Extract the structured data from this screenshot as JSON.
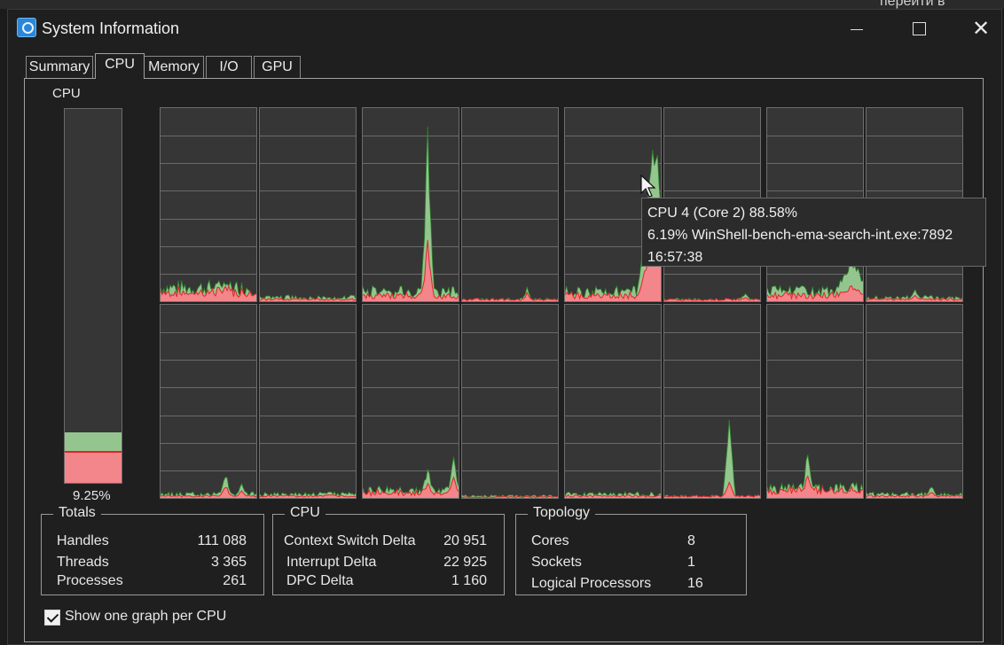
{
  "background": {
    "right_text": "перейти в"
  },
  "window": {
    "title": "System Information",
    "controls": {
      "minimize": "minimize",
      "maximize": "maximize",
      "close": "✕"
    }
  },
  "tabs": [
    {
      "label": "Summary",
      "active": false
    },
    {
      "label": "CPU",
      "active": true
    },
    {
      "label": "Memory",
      "active": false
    },
    {
      "label": "I/O",
      "active": false
    },
    {
      "label": "GPU",
      "active": false
    }
  ],
  "cpu_panel": {
    "label": "CPU",
    "total_percent_text": "9.25%",
    "total_levels": {
      "total": 0.135,
      "kernel": 0.085
    },
    "cpu_graphs_count": 16,
    "colors": {
      "user": "#95c58f",
      "kernel": "#f2868a",
      "kernel_line": "#e0242c",
      "user_line": "#2a8a2a"
    }
  },
  "tooltip": {
    "line1": "CPU 4 (Core 2) 88.58%",
    "line2": "6.19% WinShell-bench-ema-search-int.exe:7892",
    "line3": "16:57:38"
  },
  "totals": {
    "title": "Totals",
    "rows": [
      {
        "label": "Handles",
        "value": "111 088"
      },
      {
        "label": "Threads",
        "value": "3 365"
      },
      {
        "label": "Processes",
        "value": "261"
      }
    ]
  },
  "cpu_stats": {
    "title": "CPU",
    "rows": [
      {
        "label": "Context Switch Delta",
        "value": "20 951"
      },
      {
        "label": "Interrupt Delta",
        "value": "22 925"
      },
      {
        "label": "DPC Delta",
        "value": "1 160"
      }
    ]
  },
  "topology": {
    "title": "Topology",
    "rows": [
      {
        "label": "Cores",
        "value": "8"
      },
      {
        "label": "Sockets",
        "value": "1"
      },
      {
        "label": "Logical Processors",
        "value": "16"
      }
    ]
  },
  "option": {
    "label": "Show one graph per CPU",
    "checked": true
  }
}
